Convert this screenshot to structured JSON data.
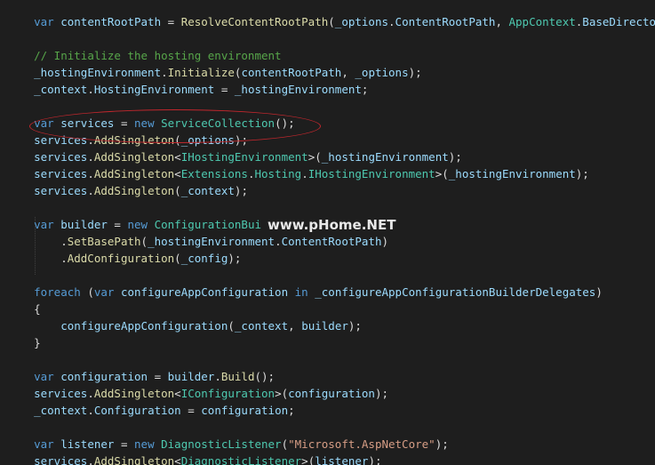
{
  "watermark": "www.pHome.NET",
  "lines": [
    {
      "tokens": [
        {
          "c": "pu",
          "t": "    "
        },
        {
          "c": "kw",
          "t": "var"
        },
        {
          "c": "pu",
          "t": " "
        },
        {
          "c": "id",
          "t": "contentRootPath"
        },
        {
          "c": "pu",
          "t": " = "
        },
        {
          "c": "me",
          "t": "ResolveContentRootPath"
        },
        {
          "c": "pu",
          "t": "("
        },
        {
          "c": "id",
          "t": "_options"
        },
        {
          "c": "pu",
          "t": "."
        },
        {
          "c": "id",
          "t": "ContentRootPath"
        },
        {
          "c": "pu",
          "t": ", "
        },
        {
          "c": "ty",
          "t": "AppContext"
        },
        {
          "c": "pu",
          "t": "."
        },
        {
          "c": "id",
          "t": "BaseDirectory"
        },
        {
          "c": "pu",
          "t": ");"
        }
      ]
    },
    {
      "tokens": []
    },
    {
      "tokens": [
        {
          "c": "pu",
          "t": "    "
        },
        {
          "c": "cm",
          "t": "// Initialize the hosting environment"
        }
      ]
    },
    {
      "tokens": [
        {
          "c": "pu",
          "t": "    "
        },
        {
          "c": "id",
          "t": "_hostingEnvironment"
        },
        {
          "c": "pu",
          "t": "."
        },
        {
          "c": "me",
          "t": "Initialize"
        },
        {
          "c": "pu",
          "t": "("
        },
        {
          "c": "id",
          "t": "contentRootPath"
        },
        {
          "c": "pu",
          "t": ", "
        },
        {
          "c": "id",
          "t": "_options"
        },
        {
          "c": "pu",
          "t": ");"
        }
      ]
    },
    {
      "tokens": [
        {
          "c": "pu",
          "t": "    "
        },
        {
          "c": "id",
          "t": "_context"
        },
        {
          "c": "pu",
          "t": "."
        },
        {
          "c": "id",
          "t": "HostingEnvironment"
        },
        {
          "c": "pu",
          "t": " = "
        },
        {
          "c": "id",
          "t": "_hostingEnvironment"
        },
        {
          "c": "pu",
          "t": ";"
        }
      ]
    },
    {
      "tokens": []
    },
    {
      "tokens": [
        {
          "c": "pu",
          "t": "    "
        },
        {
          "c": "kw",
          "t": "var"
        },
        {
          "c": "pu",
          "t": " "
        },
        {
          "c": "id",
          "t": "services"
        },
        {
          "c": "pu",
          "t": " = "
        },
        {
          "c": "kw",
          "t": "new"
        },
        {
          "c": "pu",
          "t": " "
        },
        {
          "c": "ty",
          "t": "ServiceCollection"
        },
        {
          "c": "pu",
          "t": "();"
        }
      ]
    },
    {
      "tokens": [
        {
          "c": "pu",
          "t": "    "
        },
        {
          "c": "id",
          "t": "services"
        },
        {
          "c": "pu",
          "t": "."
        },
        {
          "c": "me",
          "t": "AddSingleton"
        },
        {
          "c": "pu",
          "t": "("
        },
        {
          "c": "id",
          "t": "_options"
        },
        {
          "c": "pu",
          "t": ");"
        }
      ]
    },
    {
      "tokens": [
        {
          "c": "pu",
          "t": "    "
        },
        {
          "c": "id",
          "t": "services"
        },
        {
          "c": "pu",
          "t": "."
        },
        {
          "c": "me",
          "t": "AddSingleton"
        },
        {
          "c": "pu",
          "t": "<"
        },
        {
          "c": "ty",
          "t": "IHostingEnvironment"
        },
        {
          "c": "pu",
          "t": ">("
        },
        {
          "c": "id",
          "t": "_hostingEnvironment"
        },
        {
          "c": "pu",
          "t": ");"
        }
      ]
    },
    {
      "tokens": [
        {
          "c": "pu",
          "t": "    "
        },
        {
          "c": "id",
          "t": "services"
        },
        {
          "c": "pu",
          "t": "."
        },
        {
          "c": "me",
          "t": "AddSingleton"
        },
        {
          "c": "pu",
          "t": "<"
        },
        {
          "c": "ty",
          "t": "Extensions"
        },
        {
          "c": "pu",
          "t": "."
        },
        {
          "c": "ty",
          "t": "Hosting"
        },
        {
          "c": "pu",
          "t": "."
        },
        {
          "c": "ty",
          "t": "IHostingEnvironment"
        },
        {
          "c": "pu",
          "t": ">("
        },
        {
          "c": "id",
          "t": "_hostingEnvironment"
        },
        {
          "c": "pu",
          "t": ");"
        }
      ]
    },
    {
      "tokens": [
        {
          "c": "pu",
          "t": "    "
        },
        {
          "c": "id",
          "t": "services"
        },
        {
          "c": "pu",
          "t": "."
        },
        {
          "c": "me",
          "t": "AddSingleton"
        },
        {
          "c": "pu",
          "t": "("
        },
        {
          "c": "id",
          "t": "_context"
        },
        {
          "c": "pu",
          "t": ");"
        }
      ]
    },
    {
      "tokens": []
    },
    {
      "tokens": [
        {
          "c": "pu",
          "t": "    "
        },
        {
          "c": "kw",
          "t": "var"
        },
        {
          "c": "pu",
          "t": " "
        },
        {
          "c": "id",
          "t": "builder"
        },
        {
          "c": "pu",
          "t": " = "
        },
        {
          "c": "kw",
          "t": "new"
        },
        {
          "c": "pu",
          "t": " "
        },
        {
          "c": "ty",
          "t": "ConfigurationBui"
        }
      ]
    },
    {
      "tokens": [
        {
          "c": "pu",
          "t": "        ."
        },
        {
          "c": "me",
          "t": "SetBasePath"
        },
        {
          "c": "pu",
          "t": "("
        },
        {
          "c": "id",
          "t": "_hostingEnvironment"
        },
        {
          "c": "pu",
          "t": "."
        },
        {
          "c": "id",
          "t": "ContentRootPath"
        },
        {
          "c": "pu",
          "t": ")"
        }
      ]
    },
    {
      "tokens": [
        {
          "c": "pu",
          "t": "        ."
        },
        {
          "c": "me",
          "t": "AddConfiguration"
        },
        {
          "c": "pu",
          "t": "("
        },
        {
          "c": "id",
          "t": "_config"
        },
        {
          "c": "pu",
          "t": ");"
        }
      ]
    },
    {
      "tokens": []
    },
    {
      "tokens": [
        {
          "c": "pu",
          "t": "    "
        },
        {
          "c": "kw",
          "t": "foreach"
        },
        {
          "c": "pu",
          "t": " ("
        },
        {
          "c": "kw",
          "t": "var"
        },
        {
          "c": "pu",
          "t": " "
        },
        {
          "c": "id",
          "t": "configureAppConfiguration"
        },
        {
          "c": "pu",
          "t": " "
        },
        {
          "c": "kw",
          "t": "in"
        },
        {
          "c": "pu",
          "t": " "
        },
        {
          "c": "id",
          "t": "_configureAppConfigurationBuilderDelegates"
        },
        {
          "c": "pu",
          "t": ")"
        }
      ]
    },
    {
      "tokens": [
        {
          "c": "pu",
          "t": "    {"
        }
      ]
    },
    {
      "tokens": [
        {
          "c": "pu",
          "t": "        "
        },
        {
          "c": "id",
          "t": "configureAppConfiguration"
        },
        {
          "c": "pu",
          "t": "("
        },
        {
          "c": "id",
          "t": "_context"
        },
        {
          "c": "pu",
          "t": ", "
        },
        {
          "c": "id",
          "t": "builder"
        },
        {
          "c": "pu",
          "t": ");"
        }
      ]
    },
    {
      "tokens": [
        {
          "c": "pu",
          "t": "    }"
        }
      ]
    },
    {
      "tokens": []
    },
    {
      "tokens": [
        {
          "c": "pu",
          "t": "    "
        },
        {
          "c": "kw",
          "t": "var"
        },
        {
          "c": "pu",
          "t": " "
        },
        {
          "c": "id",
          "t": "configuration"
        },
        {
          "c": "pu",
          "t": " = "
        },
        {
          "c": "id",
          "t": "builder"
        },
        {
          "c": "pu",
          "t": "."
        },
        {
          "c": "me",
          "t": "Build"
        },
        {
          "c": "pu",
          "t": "();"
        }
      ]
    },
    {
      "tokens": [
        {
          "c": "pu",
          "t": "    "
        },
        {
          "c": "id",
          "t": "services"
        },
        {
          "c": "pu",
          "t": "."
        },
        {
          "c": "me",
          "t": "AddSingleton"
        },
        {
          "c": "pu",
          "t": "<"
        },
        {
          "c": "ty",
          "t": "IConfiguration"
        },
        {
          "c": "pu",
          "t": ">("
        },
        {
          "c": "id",
          "t": "configuration"
        },
        {
          "c": "pu",
          "t": ");"
        }
      ]
    },
    {
      "tokens": [
        {
          "c": "pu",
          "t": "    "
        },
        {
          "c": "id",
          "t": "_context"
        },
        {
          "c": "pu",
          "t": "."
        },
        {
          "c": "id",
          "t": "Configuration"
        },
        {
          "c": "pu",
          "t": " = "
        },
        {
          "c": "id",
          "t": "configuration"
        },
        {
          "c": "pu",
          "t": ";"
        }
      ]
    },
    {
      "tokens": []
    },
    {
      "tokens": [
        {
          "c": "pu",
          "t": "    "
        },
        {
          "c": "kw",
          "t": "var"
        },
        {
          "c": "pu",
          "t": " "
        },
        {
          "c": "id",
          "t": "listener"
        },
        {
          "c": "pu",
          "t": " = "
        },
        {
          "c": "kw",
          "t": "new"
        },
        {
          "c": "pu",
          "t": " "
        },
        {
          "c": "ty",
          "t": "DiagnosticListener"
        },
        {
          "c": "pu",
          "t": "("
        },
        {
          "c": "st",
          "t": "\"Microsoft.AspNetCore\""
        },
        {
          "c": "pu",
          "t": ");"
        }
      ]
    },
    {
      "tokens": [
        {
          "c": "pu",
          "t": "    "
        },
        {
          "c": "id",
          "t": "services"
        },
        {
          "c": "pu",
          "t": "."
        },
        {
          "c": "me",
          "t": "AddSingleton"
        },
        {
          "c": "pu",
          "t": "<"
        },
        {
          "c": "ty",
          "t": "DiagnosticListener"
        },
        {
          "c": "pu",
          "t": ">("
        },
        {
          "c": "id",
          "t": "listener"
        },
        {
          "c": "pu",
          "t": ");"
        }
      ]
    }
  ]
}
